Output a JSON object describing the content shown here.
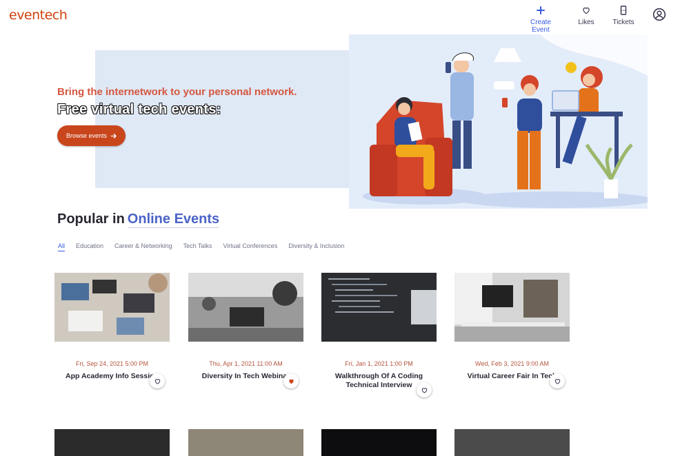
{
  "header": {
    "logo": "eventech",
    "nav": {
      "create_event": "Create Event",
      "likes": "Likes",
      "tickets": "Tickets"
    }
  },
  "hero": {
    "subtitle": "Bring the internetwork to your personal network.",
    "title": "Free virtual tech events:",
    "browse_button": "Browse events"
  },
  "popular": {
    "prefix": "Popular in",
    "location": "Online Events"
  },
  "tabs": [
    "All",
    "Education",
    "Career & Networking",
    "Tech Talks",
    "Virtual Conferences",
    "Diversity & Inclusion"
  ],
  "active_tab": "All",
  "events": [
    {
      "date": "Fri, Sep 24, 2021 5:00 PM",
      "name": "App Academy Info Session",
      "liked": false
    },
    {
      "date": "Thu, Apr 1, 2021 11:00 AM",
      "name": "Diversity In Tech Webinar",
      "liked": true
    },
    {
      "date": "Fri, Jan 1, 2021 1:00 PM",
      "name": "Walkthrough Of A Coding Technical Interview",
      "liked": false
    },
    {
      "date": "Wed, Feb 3, 2021 9:00 AM",
      "name": "Virtual Career Fair In Tech",
      "liked": false
    }
  ],
  "colors": {
    "brand": "#d1410c",
    "accent_blue": "#3659e3",
    "button": "#c9461d",
    "liked_heart": "#c9461d"
  },
  "icons": {
    "create": "plus-icon",
    "likes": "heart-icon",
    "tickets": "ticket-icon",
    "account": "user-circle-icon",
    "favorite": "heart-icon",
    "arrow": "arrow-right-icon"
  }
}
